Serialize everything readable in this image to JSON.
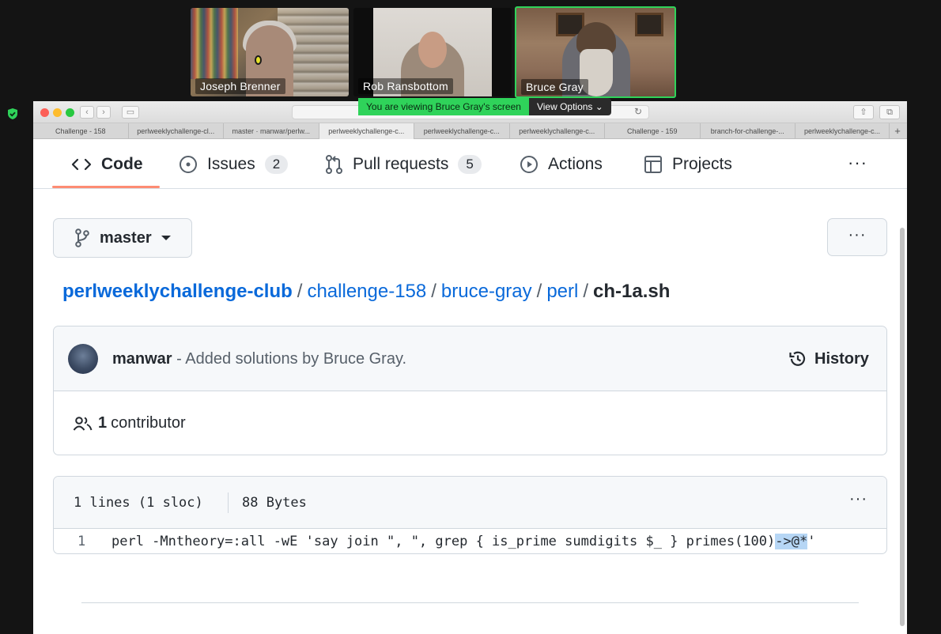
{
  "participants": [
    {
      "name": "Joseph Brenner"
    },
    {
      "name": "Rob Ransbottom"
    },
    {
      "name": "Bruce Gray"
    }
  ],
  "screen_share": {
    "viewing_text": "You are viewing Bruce Gray's screen",
    "options_label": "View Options"
  },
  "browser": {
    "tabs": [
      "Challenge - 158",
      "perlweeklychallenge-cl...",
      "master · manwar/perlw...",
      "perlweeklychallenge-c...",
      "perlweeklychallenge-c...",
      "perlweeklychallenge-c...",
      "Challenge - 159",
      "branch-for-challenge-...",
      "perlweeklychallenge-c..."
    ],
    "active_tab_index": 3
  },
  "repo_nav": {
    "code": "Code",
    "issues": "Issues",
    "issues_count": "2",
    "pull_requests": "Pull requests",
    "pull_requests_count": "5",
    "actions": "Actions",
    "projects": "Projects",
    "more": "···"
  },
  "branch": {
    "name": "master"
  },
  "more_options": "···",
  "breadcrumb": {
    "owner": "perlweeklychallenge-club",
    "seg1": "challenge-158",
    "seg2": "bruce-gray",
    "seg3": "perl",
    "file": "ch-1a.sh",
    "separator": "/"
  },
  "commit": {
    "author": "manwar",
    "message": " - Added solutions by Bruce Gray.",
    "history_label": "History",
    "contributors_count": "1",
    "contributors_label": "contributor"
  },
  "file": {
    "lines_info": "1 lines (1 sloc)",
    "size": "88 Bytes",
    "more": "···",
    "line_number": "1",
    "code_main": "perl -Mntheory=:all -wE 'say join \", \", grep { is_prime sumdigits $_ } primes(100)",
    "code_selected": "->@*",
    "code_end": "'"
  },
  "colors": {
    "accent_underline": "#fd8c73",
    "link": "#0969da",
    "share_green": "#2fd35a",
    "selection": "#b6d6f5"
  }
}
